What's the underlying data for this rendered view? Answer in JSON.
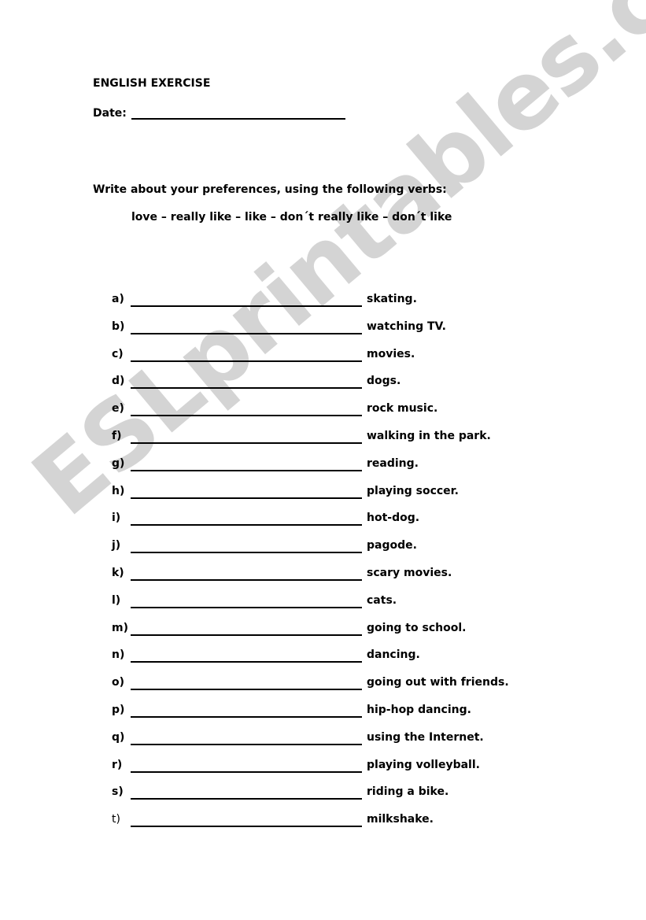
{
  "watermark": "ESLprintables.com",
  "header": {
    "title": "ENGLISH EXERCISE",
    "date_label": "Date:"
  },
  "instructions": {
    "text": "Write about your preferences, using the following verbs:",
    "verbs": "love – really like – like – don´t really like – don´t like"
  },
  "items": [
    {
      "letter": "a)",
      "phrase": "skating."
    },
    {
      "letter": "b)",
      "phrase": "watching TV."
    },
    {
      "letter": "c)",
      "phrase": "movies."
    },
    {
      "letter": "d)",
      "phrase": "dogs."
    },
    {
      "letter": "e)",
      "phrase": "rock music."
    },
    {
      "letter": "f)",
      "phrase": "walking in the park."
    },
    {
      "letter": "g)",
      "phrase": "reading."
    },
    {
      "letter": "h)",
      "phrase": "playing soccer."
    },
    {
      "letter": "i)",
      "phrase": "hot-dog."
    },
    {
      "letter": "j)",
      "phrase": "pagode."
    },
    {
      "letter": "k)",
      "phrase": "scary movies."
    },
    {
      "letter": "l)",
      "phrase": "cats."
    },
    {
      "letter": "m)",
      "phrase": "going to school."
    },
    {
      "letter": "n)",
      "phrase": "dancing."
    },
    {
      "letter": "o)",
      "phrase": "going out with friends."
    },
    {
      "letter": "p)",
      "phrase": "hip-hop dancing."
    },
    {
      "letter": "q)",
      "phrase": "using the Internet."
    },
    {
      "letter": "r)",
      "phrase": "playing volleyball."
    },
    {
      "letter": "s)",
      "phrase": "riding a bike."
    },
    {
      "letter": "t)",
      "phrase": "milkshake."
    }
  ]
}
